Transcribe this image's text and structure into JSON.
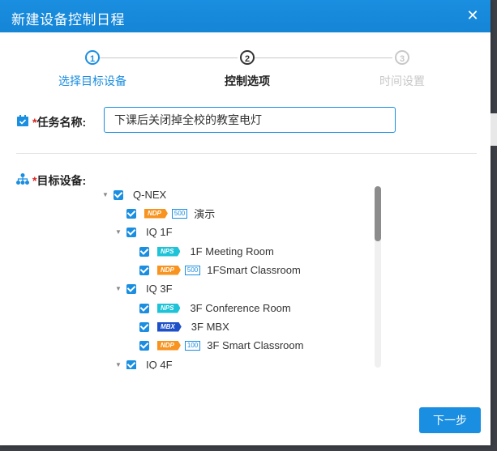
{
  "dialog": {
    "title": "新建设备控制日程",
    "close_glyph": "✕"
  },
  "steps": [
    {
      "number": "1",
      "label": "选择目标设备",
      "state": "done"
    },
    {
      "number": "2",
      "label": "控制选项",
      "state": "active"
    },
    {
      "number": "3",
      "label": "时间设置",
      "state": "pending"
    }
  ],
  "task": {
    "required_mark": "*",
    "label": "任务名称:",
    "value": "下课后关闭掉全校的教室电灯",
    "icon": "calendar-check-icon"
  },
  "target": {
    "required_mark": "*",
    "label": "目标设备:",
    "icon": "org-tree-icon"
  },
  "tree": [
    {
      "label": "Q-NEX",
      "caret": "▼",
      "checked": true
    },
    {
      "label": "演示",
      "badge": "NDP",
      "capacity": "500",
      "checked": true
    },
    {
      "label": "IQ 1F",
      "caret": "▼",
      "checked": true
    },
    {
      "label": "1F Meeting Room",
      "badge": "NPS",
      "checked": true
    },
    {
      "label": "1FSmart Classroom",
      "badge": "NDP",
      "capacity": "500",
      "checked": true
    },
    {
      "label": "IQ 3F",
      "caret": "▼",
      "checked": true
    },
    {
      "label": "3F Conference Room",
      "badge": "NPS",
      "checked": true
    },
    {
      "label": "3F MBX",
      "badge": "MBX",
      "checked": true
    },
    {
      "label": "3F Smart Classroom",
      "badge": "NDP",
      "capacity": "100",
      "checked": true
    },
    {
      "label": "IQ 4F",
      "caret": "▼",
      "checked": true
    }
  ],
  "footer": {
    "next_label": "下一步"
  },
  "colors": {
    "accent": "#1a8ee0",
    "ndp": "#f7931e",
    "nps": "#1fc3d8",
    "mbx": "#1e50c8",
    "required": "#e02020"
  }
}
